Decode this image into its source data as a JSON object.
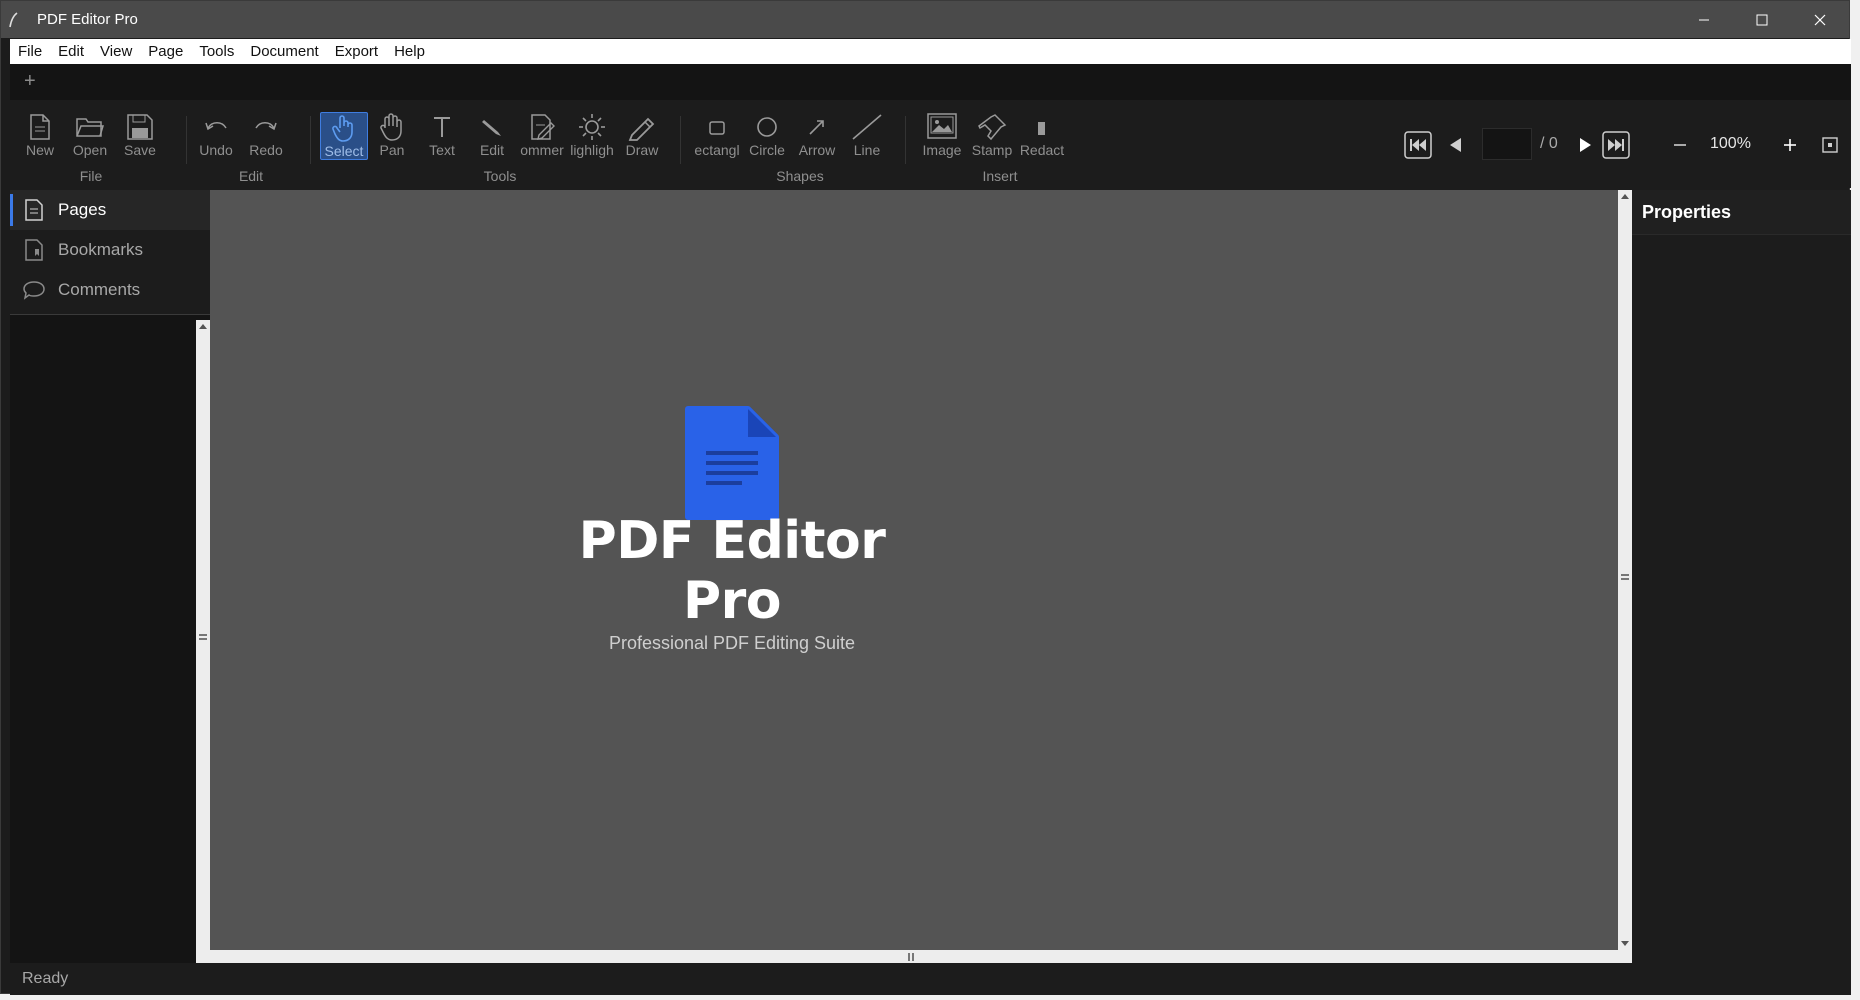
{
  "window": {
    "title": "PDF Editor Pro"
  },
  "menu": [
    "File",
    "Edit",
    "View",
    "Page",
    "Tools",
    "Document",
    "Export",
    "Help"
  ],
  "tabs": {
    "add_label": "+"
  },
  "toolbar": {
    "buttons": {
      "new": "New",
      "open": "Open",
      "save": "Save",
      "undo": "Undo",
      "redo": "Redo",
      "select": "Select",
      "pan": "Pan",
      "text": "Text",
      "edit": "Edit",
      "comment": "ommer",
      "highlight": "lighligh",
      "draw": "Draw",
      "rectangle": "ectangl",
      "circle": "Circle",
      "arrow": "Arrow",
      "line": "Line",
      "image": "Image",
      "stamp": "Stamp",
      "redact": "Redact"
    },
    "groups": {
      "file": "File",
      "edit": "Edit",
      "tools": "Tools",
      "shapes": "Shapes",
      "insert": "Insert"
    },
    "active_tool": "select",
    "page_input": "",
    "page_total": "/ 0",
    "zoom": "100%"
  },
  "sidebar": {
    "tabs": [
      {
        "label": "Pages",
        "icon": "pages-icon",
        "active": true
      },
      {
        "label": "Bookmarks",
        "icon": "bookmark-icon",
        "active": false
      },
      {
        "label": "Comments",
        "icon": "comment-icon",
        "active": false
      }
    ]
  },
  "welcome": {
    "title": "PDF Editor Pro",
    "subtitle": "Professional PDF Editing Suite"
  },
  "properties": {
    "title": "Properties"
  },
  "status": {
    "text": "Ready"
  },
  "colors": {
    "accent": "#3b7ae8",
    "logo": "#2962e8",
    "canvas": "#545454",
    "active_tool_bg": "#2a4f88"
  }
}
